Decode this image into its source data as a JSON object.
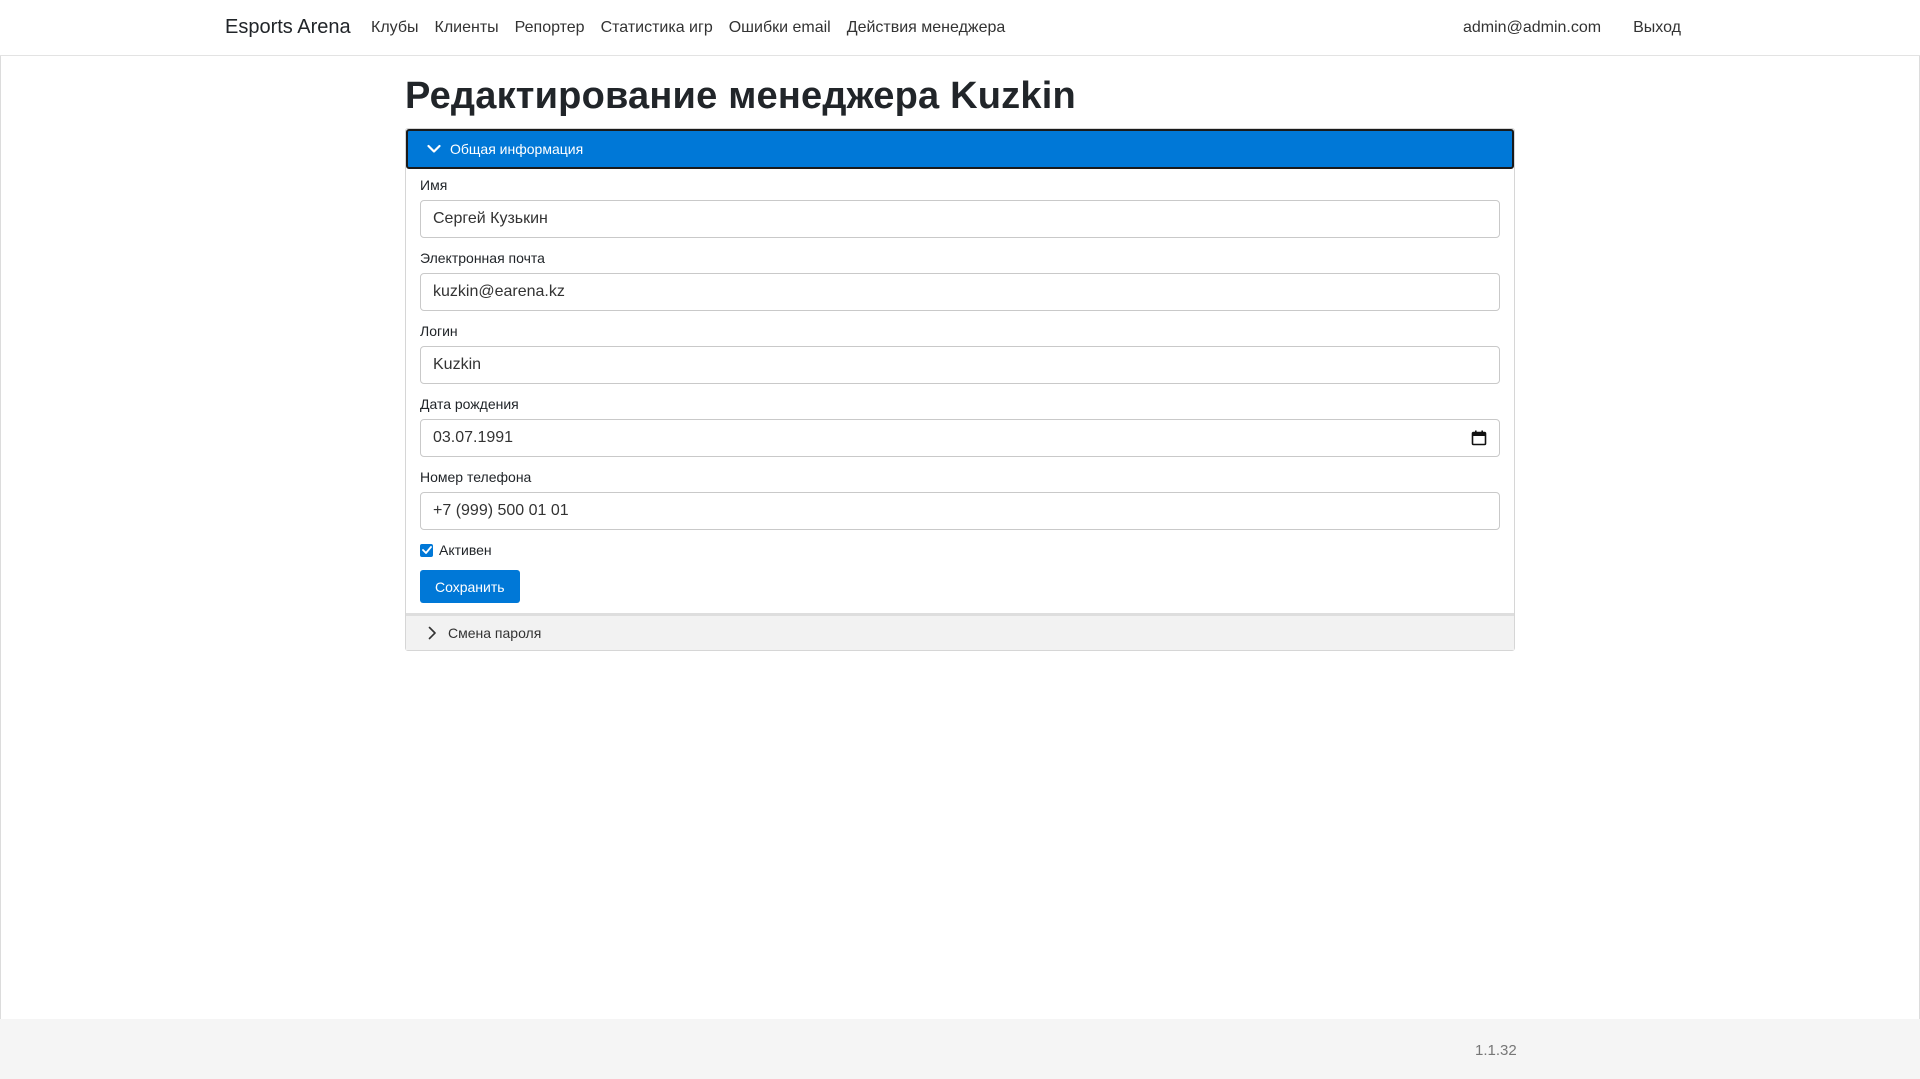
{
  "navbar": {
    "brand": "Esports Arena",
    "links": [
      "Клубы",
      "Клиенты",
      "Репортер",
      "Статистика игр",
      "Ошибки email",
      "Действия менеджера"
    ],
    "user_email": "admin@admin.com",
    "logout": "Выход"
  },
  "page": {
    "title": "Редактирование менеджера Kuzkin"
  },
  "general_section": {
    "header": "Общая информация",
    "expanded": true,
    "fields": {
      "name": {
        "label": "Имя",
        "value": "Сергей Кузькин"
      },
      "email": {
        "label": "Электронная почта",
        "value": "kuzkin@earena.kz"
      },
      "login": {
        "label": "Логин",
        "value": "Kuzkin"
      },
      "birthdate": {
        "label": "Дата рождения",
        "value": "03.07.1991"
      },
      "phone": {
        "label": "Номер телефона",
        "value": "+7 (999) 500 01 01"
      }
    },
    "active": {
      "label": "Активен",
      "checked": true
    },
    "save_label": "Сохранить"
  },
  "password_section": {
    "header": "Смена пароля",
    "expanded": false
  },
  "footer": {
    "version": "1.1.32"
  },
  "colors": {
    "accent": "#0078d7",
    "text": "#212529",
    "footer_bg": "#f5f5f5"
  },
  "icons": {
    "general_section": "chevron-down-icon",
    "password_section": "chevron-right-icon",
    "birthdate": "calendar-icon",
    "active": "check-icon"
  }
}
